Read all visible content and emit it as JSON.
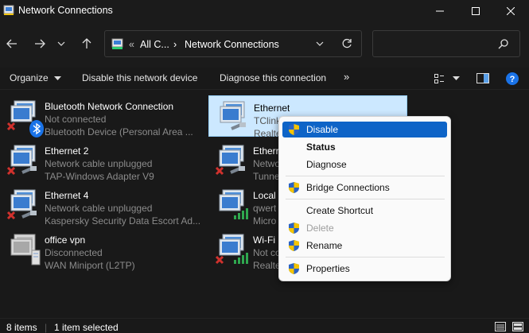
{
  "window": {
    "title": "Network Connections"
  },
  "address": {
    "overflow": "«",
    "crumb1": "All C...",
    "separator": "›",
    "crumb2": "Network Connections"
  },
  "search": {
    "placeholder": ""
  },
  "toolbar": {
    "organize": "Organize",
    "disable": "Disable this network device",
    "diagnose": "Diagnose this connection",
    "more": "»"
  },
  "items": [
    {
      "name": "Bluetooth Network Connection",
      "status": "Not connected",
      "device": "Bluetooth Device (Personal Area ..."
    },
    {
      "name": "Ethernet",
      "status": "TClink",
      "device": "Realte"
    },
    {
      "name": "Ethernet 2",
      "status": "Network cable unplugged",
      "device": "TAP-Windows Adapter V9"
    },
    {
      "name": "Etherr",
      "status": "Netwo",
      "device": "Tunne"
    },
    {
      "name": "Ethernet 4",
      "status": "Network cable unplugged",
      "device": "Kaspersky Security Data Escort Ad..."
    },
    {
      "name": "Local",
      "status": "qwert",
      "device": "Micro"
    },
    {
      "name": "office vpn",
      "status": "Disconnected",
      "device": "WAN Miniport (L2TP)"
    },
    {
      "name": "Wi-Fi",
      "status": "Not co",
      "device": "Realte"
    }
  ],
  "context_menu": {
    "disable": "Disable",
    "status": "Status",
    "diagnose": "Diagnose",
    "bridge": "Bridge Connections",
    "shortcut": "Create Shortcut",
    "delete": "Delete",
    "rename": "Rename",
    "properties": "Properties"
  },
  "status_bar": {
    "count": "8 items",
    "selected": "1 item selected"
  },
  "colors": {
    "accent": "#0e64c7",
    "selection": "#cce8ff",
    "background": "#191919",
    "error": "#d0312d"
  }
}
